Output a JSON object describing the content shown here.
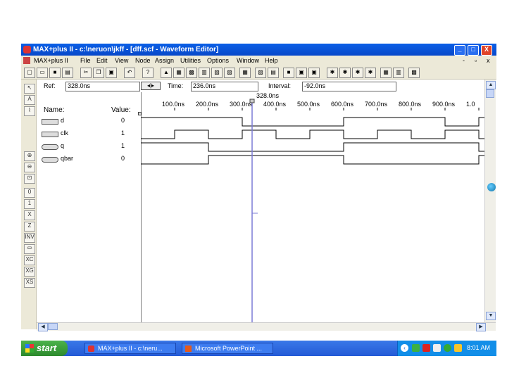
{
  "window": {
    "title": "MAX+plus II - c:\\neruon\\jkff - [dff.scf - Waveform Editor]",
    "minimize": "_",
    "maximize": "□",
    "close": "X"
  },
  "menu": {
    "items": [
      "MAX+plus II",
      "File",
      "Edit",
      "View",
      "Node",
      "Assign",
      "Utilities",
      "Options",
      "Window",
      "Help"
    ],
    "controls": [
      "-",
      "▫",
      "x"
    ]
  },
  "header": {
    "ref_label": "Ref:",
    "ref_value": "328.0ns",
    "time_label": "Time:",
    "time_value": "236.0ns",
    "interval_label": "Interval:",
    "interval_value": "-92.0ns",
    "cursor_time": "328.0ns",
    "name_col": "Name:",
    "value_col": "Value:"
  },
  "timeline": {
    "ticks": [
      "100.0ns",
      "200.0ns",
      "300.0ns",
      "400.0ns",
      "500.0ns",
      "600.0ns",
      "700.0ns",
      "800.0ns",
      "900.0ns",
      "1.0"
    ]
  },
  "signals": [
    {
      "name": "d",
      "value": "0",
      "type": "input"
    },
    {
      "name": "clk",
      "value": "1",
      "type": "input"
    },
    {
      "name": "q",
      "value": "1",
      "type": "output"
    },
    {
      "name": "qbar",
      "value": "0",
      "type": "output"
    }
  ],
  "waveforms": {
    "time_range": [
      0,
      1000
    ],
    "d": {
      "initial": 1,
      "transitions": [
        150,
        300,
        450,
        500,
        620,
        750,
        840,
        900
      ]
    },
    "clk": {
      "initial": 0,
      "transitions": [
        50,
        100,
        150,
        200,
        250,
        300,
        350,
        400,
        450,
        500,
        550,
        600,
        650,
        700,
        750,
        800,
        850,
        900
      ]
    },
    "q": {
      "initial": 1,
      "transitions": [
        100,
        300,
        500,
        600
      ]
    },
    "qbar": {
      "initial": 0,
      "transitions": [
        100,
        300,
        500,
        600
      ]
    }
  },
  "taskbar": {
    "start": "start",
    "tasks": [
      "MAX+plus II - c:\\neru...",
      "Microsoft PowerPoint ..."
    ],
    "clock": "8:01 AM"
  },
  "colors": {
    "titlebar": "#0a5fe6",
    "cursor": "#7b7bd6",
    "taskbar": "#245ad6",
    "start": "#2d8a2d"
  }
}
